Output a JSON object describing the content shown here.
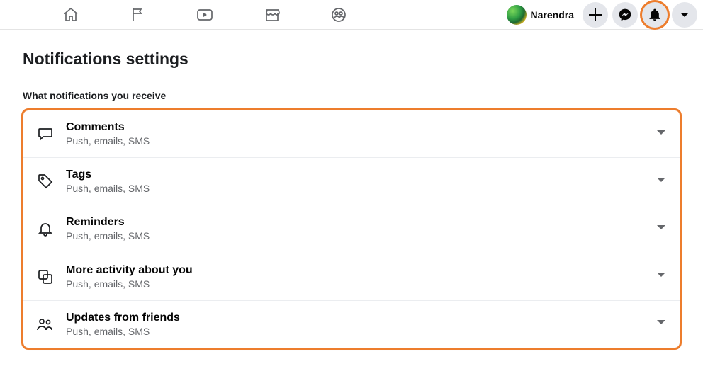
{
  "header": {
    "user_name": "Narendra"
  },
  "page": {
    "title": "Notifications settings",
    "section_label": "What notifications you receive"
  },
  "rows": [
    {
      "title": "Comments",
      "sub": "Push, emails, SMS"
    },
    {
      "title": "Tags",
      "sub": "Push, emails, SMS"
    },
    {
      "title": "Reminders",
      "sub": "Push, emails, SMS"
    },
    {
      "title": "More activity about you",
      "sub": "Push, emails, SMS"
    },
    {
      "title": "Updates from friends",
      "sub": "Push, emails, SMS"
    }
  ]
}
